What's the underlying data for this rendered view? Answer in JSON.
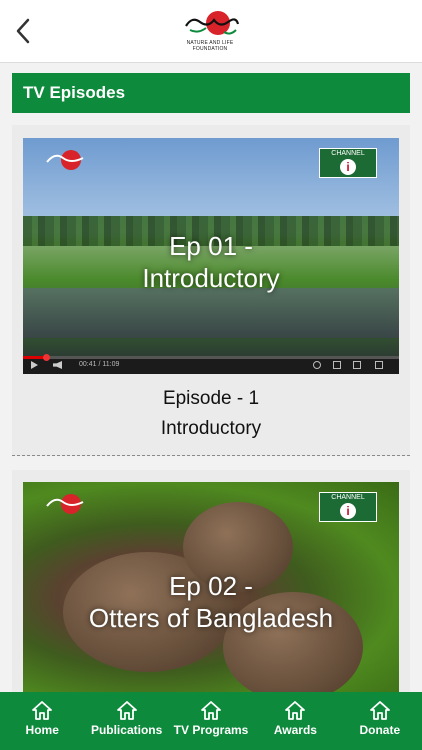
{
  "header": {
    "back_icon": "chevron-left-icon",
    "logo_tagline_1": "NATURE AND LIFE",
    "logo_tagline_2": "FOUNDATION"
  },
  "section": {
    "title": "TV Episodes"
  },
  "episodes": [
    {
      "overlay_line1": "Ep 01 -",
      "overlay_line2": "Introductory",
      "name_line1": "Episode - 1",
      "name_line2": "Introductory",
      "channel_label": "CHANNEL",
      "channel_number": "i",
      "player_time": "00:41 / 11:09",
      "progress": 0.06
    },
    {
      "overlay_line1": "Ep 02 -",
      "overlay_line2": "Otters of Bangladesh",
      "channel_label": "CHANNEL",
      "channel_number": "i"
    }
  ],
  "tabbar": {
    "items": [
      {
        "label": "Home",
        "icon": "home-icon"
      },
      {
        "label": "Publications",
        "icon": "home-icon"
      },
      {
        "label": "TV Programs",
        "icon": "home-icon"
      },
      {
        "label": "Awards",
        "icon": "home-icon"
      },
      {
        "label": "Donate",
        "icon": "home-icon"
      }
    ]
  },
  "colors": {
    "brand_green": "#0e8a3c",
    "logo_red": "#d8232a"
  }
}
